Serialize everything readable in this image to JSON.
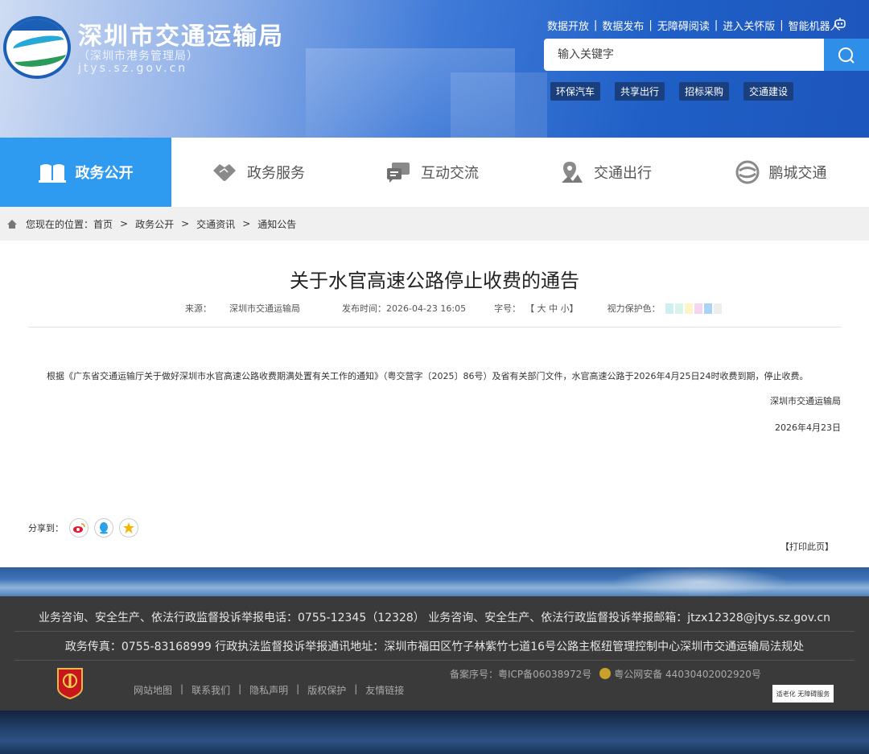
{
  "header": {
    "site_title": "深圳市交通运输局",
    "site_subtitle": "（深圳市港务管理局）",
    "site_domain": "jtys.sz.gov.cn",
    "top_links": [
      "数据开放",
      "数据发布",
      "无障碍阅读",
      "进入关怀版",
      "智能机器人"
    ],
    "search_placeholder": "输入关键字",
    "hot_tags": [
      "环保汽车",
      "共享出行",
      "招标采购",
      "交通建设"
    ]
  },
  "nav": {
    "items": [
      {
        "label": "政务公开",
        "icon": "book-icon",
        "active": true
      },
      {
        "label": "政务服务",
        "icon": "handshake-icon",
        "active": false
      },
      {
        "label": "互动交流",
        "icon": "chat-icon",
        "active": false
      },
      {
        "label": "交通出行",
        "icon": "map-pin-icon",
        "active": false
      },
      {
        "label": "鹏城交通",
        "icon": "swirl-logo-icon",
        "active": false
      }
    ]
  },
  "breadcrumb": {
    "prefix": "您现在的位置：",
    "items": [
      "首页",
      "政务公开",
      "交通资讯",
      "通知公告"
    ],
    "separator": ">"
  },
  "article": {
    "title": "关于水官高速公路停止收费的通告",
    "source_label": "来源：",
    "source": "深圳市交通运输局",
    "date_label": "发布时间：",
    "date": "2026-04-23 16:05",
    "font_label": "字号：",
    "font_sizes": "【 大 中 小】",
    "eye_label": "视力保护色：",
    "eye_colors": [
      "#cdeff2",
      "#d8f5ea",
      "#fbf5c8",
      "#f6d5f2",
      "#a9d4f7",
      "#eeeeee"
    ],
    "body": "根据《广东省交通运输厅关于做好深圳市水官高速公路收费期满处置有关工作的通知》（粤交营字〔2025〕86号）及省有关部门文件，水官高速公路于2026年4月25日24时收费到期，停止收费。",
    "signature": "深圳市交通运输局",
    "sign_date": "2026年4月23日",
    "share_label": "分享到：",
    "share_icons": [
      "weibo-icon",
      "qq-icon",
      "qzone-star-icon"
    ],
    "print_label": "【打印此页】"
  },
  "footer": {
    "line1": "业务咨询、安全生产、依法行政监督投诉举报电话：0755-12345（12328）    业务咨询、安全生产、依法行政监督投诉举报邮箱：jtzx12328@jtys.sz.gov.cn",
    "line2": "政务传真：0755-83168999    行政执法监督投诉举报通讯地址：深圳市福田区竹子林紫竹七道16号公路主枢纽管理控制中心深圳市交通运输局法规处",
    "links": [
      "网站地图",
      "联系我们",
      "隐私声明",
      "版权保护",
      "友情链接"
    ],
    "icp": "备案序号：粤ICP备06038972号",
    "police": "粤公网安备 44030402002920号",
    "access_badge": "适老化 无障碍服务"
  }
}
